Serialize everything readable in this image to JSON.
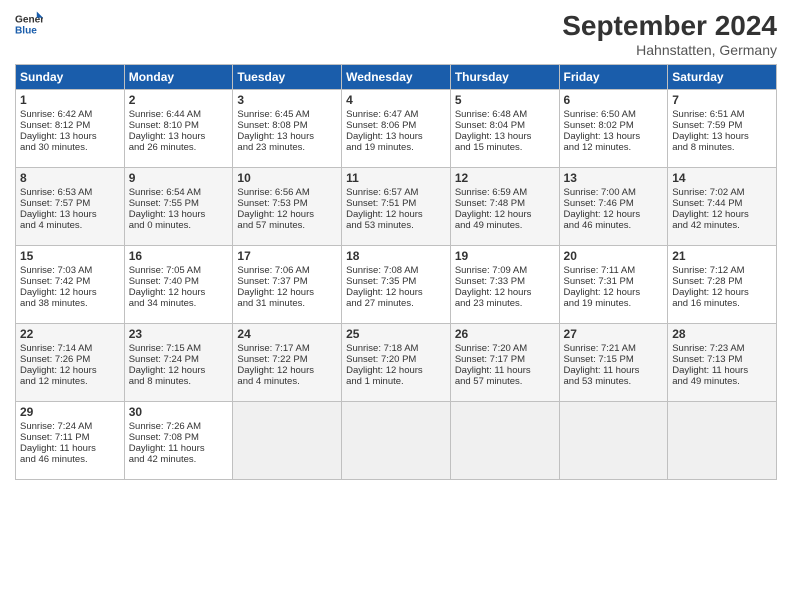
{
  "header": {
    "logo_line1": "General",
    "logo_line2": "Blue",
    "month": "September 2024",
    "location": "Hahnstatten, Germany"
  },
  "weekdays": [
    "Sunday",
    "Monday",
    "Tuesday",
    "Wednesday",
    "Thursday",
    "Friday",
    "Saturday"
  ],
  "weeks": [
    [
      {
        "day": "1",
        "lines": [
          "Sunrise: 6:42 AM",
          "Sunset: 8:12 PM",
          "Daylight: 13 hours",
          "and 30 minutes."
        ]
      },
      {
        "day": "2",
        "lines": [
          "Sunrise: 6:44 AM",
          "Sunset: 8:10 PM",
          "Daylight: 13 hours",
          "and 26 minutes."
        ]
      },
      {
        "day": "3",
        "lines": [
          "Sunrise: 6:45 AM",
          "Sunset: 8:08 PM",
          "Daylight: 13 hours",
          "and 23 minutes."
        ]
      },
      {
        "day": "4",
        "lines": [
          "Sunrise: 6:47 AM",
          "Sunset: 8:06 PM",
          "Daylight: 13 hours",
          "and 19 minutes."
        ]
      },
      {
        "day": "5",
        "lines": [
          "Sunrise: 6:48 AM",
          "Sunset: 8:04 PM",
          "Daylight: 13 hours",
          "and 15 minutes."
        ]
      },
      {
        "day": "6",
        "lines": [
          "Sunrise: 6:50 AM",
          "Sunset: 8:02 PM",
          "Daylight: 13 hours",
          "and 12 minutes."
        ]
      },
      {
        "day": "7",
        "lines": [
          "Sunrise: 6:51 AM",
          "Sunset: 7:59 PM",
          "Daylight: 13 hours",
          "and 8 minutes."
        ]
      }
    ],
    [
      {
        "day": "8",
        "lines": [
          "Sunrise: 6:53 AM",
          "Sunset: 7:57 PM",
          "Daylight: 13 hours",
          "and 4 minutes."
        ]
      },
      {
        "day": "9",
        "lines": [
          "Sunrise: 6:54 AM",
          "Sunset: 7:55 PM",
          "Daylight: 13 hours",
          "and 0 minutes."
        ]
      },
      {
        "day": "10",
        "lines": [
          "Sunrise: 6:56 AM",
          "Sunset: 7:53 PM",
          "Daylight: 12 hours",
          "and 57 minutes."
        ]
      },
      {
        "day": "11",
        "lines": [
          "Sunrise: 6:57 AM",
          "Sunset: 7:51 PM",
          "Daylight: 12 hours",
          "and 53 minutes."
        ]
      },
      {
        "day": "12",
        "lines": [
          "Sunrise: 6:59 AM",
          "Sunset: 7:48 PM",
          "Daylight: 12 hours",
          "and 49 minutes."
        ]
      },
      {
        "day": "13",
        "lines": [
          "Sunrise: 7:00 AM",
          "Sunset: 7:46 PM",
          "Daylight: 12 hours",
          "and 46 minutes."
        ]
      },
      {
        "day": "14",
        "lines": [
          "Sunrise: 7:02 AM",
          "Sunset: 7:44 PM",
          "Daylight: 12 hours",
          "and 42 minutes."
        ]
      }
    ],
    [
      {
        "day": "15",
        "lines": [
          "Sunrise: 7:03 AM",
          "Sunset: 7:42 PM",
          "Daylight: 12 hours",
          "and 38 minutes."
        ]
      },
      {
        "day": "16",
        "lines": [
          "Sunrise: 7:05 AM",
          "Sunset: 7:40 PM",
          "Daylight: 12 hours",
          "and 34 minutes."
        ]
      },
      {
        "day": "17",
        "lines": [
          "Sunrise: 7:06 AM",
          "Sunset: 7:37 PM",
          "Daylight: 12 hours",
          "and 31 minutes."
        ]
      },
      {
        "day": "18",
        "lines": [
          "Sunrise: 7:08 AM",
          "Sunset: 7:35 PM",
          "Daylight: 12 hours",
          "and 27 minutes."
        ]
      },
      {
        "day": "19",
        "lines": [
          "Sunrise: 7:09 AM",
          "Sunset: 7:33 PM",
          "Daylight: 12 hours",
          "and 23 minutes."
        ]
      },
      {
        "day": "20",
        "lines": [
          "Sunrise: 7:11 AM",
          "Sunset: 7:31 PM",
          "Daylight: 12 hours",
          "and 19 minutes."
        ]
      },
      {
        "day": "21",
        "lines": [
          "Sunrise: 7:12 AM",
          "Sunset: 7:28 PM",
          "Daylight: 12 hours",
          "and 16 minutes."
        ]
      }
    ],
    [
      {
        "day": "22",
        "lines": [
          "Sunrise: 7:14 AM",
          "Sunset: 7:26 PM",
          "Daylight: 12 hours",
          "and 12 minutes."
        ]
      },
      {
        "day": "23",
        "lines": [
          "Sunrise: 7:15 AM",
          "Sunset: 7:24 PM",
          "Daylight: 12 hours",
          "and 8 minutes."
        ]
      },
      {
        "day": "24",
        "lines": [
          "Sunrise: 7:17 AM",
          "Sunset: 7:22 PM",
          "Daylight: 12 hours",
          "and 4 minutes."
        ]
      },
      {
        "day": "25",
        "lines": [
          "Sunrise: 7:18 AM",
          "Sunset: 7:20 PM",
          "Daylight: 12 hours",
          "and 1 minute."
        ]
      },
      {
        "day": "26",
        "lines": [
          "Sunrise: 7:20 AM",
          "Sunset: 7:17 PM",
          "Daylight: 11 hours",
          "and 57 minutes."
        ]
      },
      {
        "day": "27",
        "lines": [
          "Sunrise: 7:21 AM",
          "Sunset: 7:15 PM",
          "Daylight: 11 hours",
          "and 53 minutes."
        ]
      },
      {
        "day": "28",
        "lines": [
          "Sunrise: 7:23 AM",
          "Sunset: 7:13 PM",
          "Daylight: 11 hours",
          "and 49 minutes."
        ]
      }
    ],
    [
      {
        "day": "29",
        "lines": [
          "Sunrise: 7:24 AM",
          "Sunset: 7:11 PM",
          "Daylight: 11 hours",
          "and 46 minutes."
        ]
      },
      {
        "day": "30",
        "lines": [
          "Sunrise: 7:26 AM",
          "Sunset: 7:08 PM",
          "Daylight: 11 hours",
          "and 42 minutes."
        ]
      },
      {
        "day": "",
        "lines": []
      },
      {
        "day": "",
        "lines": []
      },
      {
        "day": "",
        "lines": []
      },
      {
        "day": "",
        "lines": []
      },
      {
        "day": "",
        "lines": []
      }
    ]
  ]
}
